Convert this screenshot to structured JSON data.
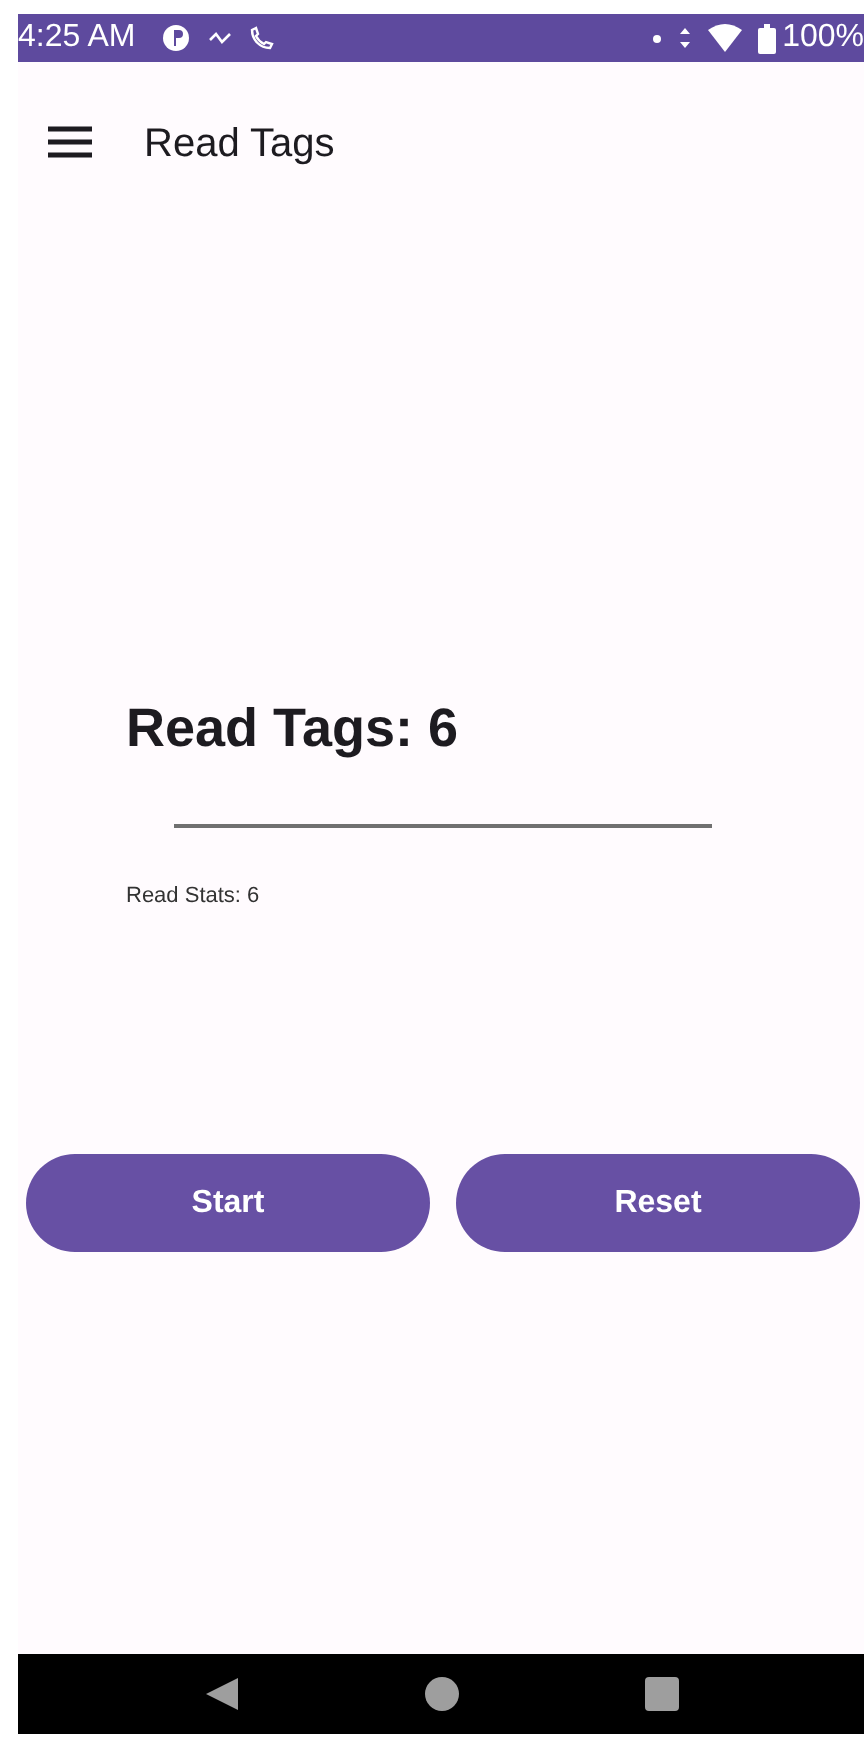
{
  "status_bar": {
    "time": "4:25 AM",
    "battery": "100%"
  },
  "app_bar": {
    "title": "Read Tags"
  },
  "count": {
    "label": "Read Tags: 6"
  },
  "stats": {
    "label": "Read Stats: 6"
  },
  "buttons": [
    {
      "label": "Start"
    },
    {
      "label": "Reset"
    }
  ]
}
